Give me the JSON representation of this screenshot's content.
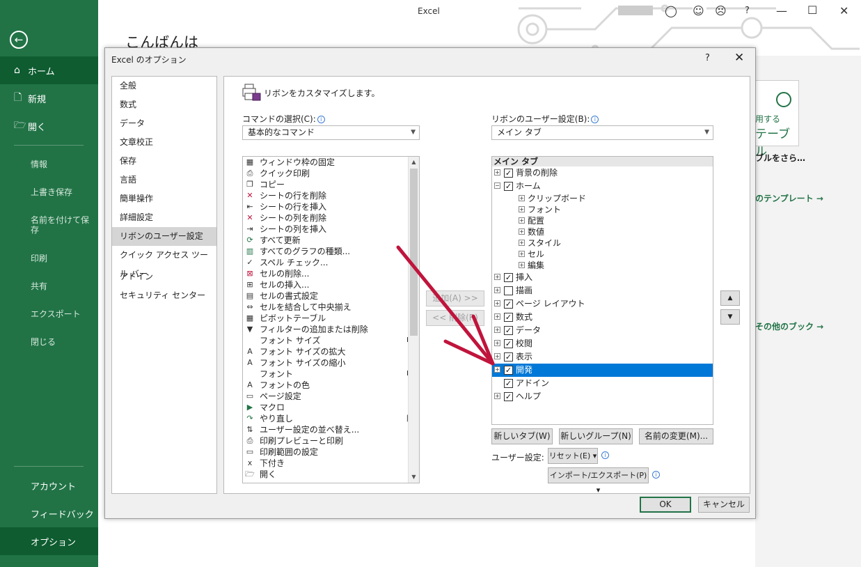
{
  "app": {
    "title": "Excel",
    "greeting": "こんばんは"
  },
  "backstage": {
    "main_items": [
      {
        "label": "ホーム",
        "icon": "home-icon"
      },
      {
        "label": "新規",
        "icon": "new-file-icon"
      },
      {
        "label": "開く",
        "icon": "folder-open-icon"
      }
    ],
    "sub_items": [
      "情報",
      "上書き保存",
      "名前を付けて保存",
      "印刷",
      "共有",
      "エクスポート",
      "閉じる"
    ],
    "bottom_items": [
      "アカウント",
      "フィードバック",
      "オプション"
    ]
  },
  "background": {
    "card_line1": "用する",
    "card_line2": "テーブル",
    "card_line3": "ブルをさら…",
    "link1": "のテンプレート →",
    "link2": "その他のブック →"
  },
  "dialog": {
    "title": "Excel のオプション",
    "help": "?",
    "close": "✕",
    "nav": [
      "全般",
      "数式",
      "データ",
      "文章校正",
      "保存",
      "言語",
      "簡単操作",
      "詳細設定",
      "リボンのユーザー設定",
      "クイック アクセス ツール バー",
      "アドイン",
      "セキュリティ センター"
    ],
    "nav_selected": 8,
    "heading": "リボンをカスタマイズします。",
    "commands_label": "コマンドの選択(C):",
    "commands_combo": "基本的なコマンド",
    "ribbon_label": "リボンのユーザー設定(B):",
    "ribbon_combo": "メイン タブ",
    "commands": [
      {
        "label": "ウィンドウ枠の固定",
        "icon": "freeze-panes-icon",
        "right": "▸"
      },
      {
        "label": "クイック印刷",
        "icon": "quick-print-icon",
        "right": ""
      },
      {
        "label": "コピー",
        "icon": "copy-icon",
        "right": ""
      },
      {
        "label": "シートの行を削除",
        "icon": "delete-row-icon",
        "right": ""
      },
      {
        "label": "シートの行を挿入",
        "icon": "insert-row-icon",
        "right": ""
      },
      {
        "label": "シートの列を削除",
        "icon": "delete-column-icon",
        "right": ""
      },
      {
        "label": "シートの列を挿入",
        "icon": "insert-column-icon",
        "right": ""
      },
      {
        "label": "すべて更新",
        "icon": "refresh-all-icon",
        "right": ""
      },
      {
        "label": "すべてのグラフの種類...",
        "icon": "chart-icon",
        "right": ""
      },
      {
        "label": "スペル チェック...",
        "icon": "spelling-icon",
        "right": ""
      },
      {
        "label": "セルの削除...",
        "icon": "delete-cells-icon",
        "right": ""
      },
      {
        "label": "セルの挿入...",
        "icon": "insert-cells-icon",
        "right": ""
      },
      {
        "label": "セルの書式設定",
        "icon": "format-cells-icon",
        "right": ""
      },
      {
        "label": "セルを結合して中央揃え",
        "icon": "merge-center-icon",
        "right": ""
      },
      {
        "label": "ピボットテーブル",
        "icon": "pivot-table-icon",
        "right": ""
      },
      {
        "label": "フィルターの追加または削除",
        "icon": "filter-icon",
        "right": ""
      },
      {
        "label": "フォント サイズ",
        "icon": "",
        "right": "I▾"
      },
      {
        "label": "フォント サイズの拡大",
        "icon": "font-grow-icon",
        "right": ""
      },
      {
        "label": "フォント サイズの縮小",
        "icon": "font-shrink-icon",
        "right": ""
      },
      {
        "label": "フォント",
        "icon": "",
        "right": "I▾"
      },
      {
        "label": "フォントの色",
        "icon": "font-color-icon",
        "right": "▸"
      },
      {
        "label": "ページ設定",
        "icon": "page-setup-icon",
        "right": ""
      },
      {
        "label": "マクロ",
        "icon": "macro-icon",
        "right": ""
      },
      {
        "label": "やり直し",
        "icon": "redo-icon",
        "right": "|▸"
      },
      {
        "label": "ユーザー設定の並べ替え...",
        "icon": "custom-sort-icon",
        "right": ""
      },
      {
        "label": "印刷プレビューと印刷",
        "icon": "print-preview-icon",
        "right": ""
      },
      {
        "label": "印刷範囲の設定",
        "icon": "print-area-icon",
        "right": ""
      },
      {
        "label": "下付き",
        "icon": "subscript-icon",
        "right": ""
      },
      {
        "label": "開く",
        "icon": "open-icon",
        "right": ""
      }
    ],
    "add_button": "追加(A) >>",
    "remove_button": "<< 削除(R)",
    "tree_header": "メイン タブ",
    "tree": [
      {
        "label": "背景の削除",
        "level": 0,
        "expand": "+",
        "checked": true
      },
      {
        "label": "ホーム",
        "level": 0,
        "expand": "−",
        "checked": true
      },
      {
        "label": "クリップボード",
        "level": 1,
        "expand": "+"
      },
      {
        "label": "フォント",
        "level": 1,
        "expand": "+"
      },
      {
        "label": "配置",
        "level": 1,
        "expand": "+"
      },
      {
        "label": "数値",
        "level": 1,
        "expand": "+"
      },
      {
        "label": "スタイル",
        "level": 1,
        "expand": "+"
      },
      {
        "label": "セル",
        "level": 1,
        "expand": "+"
      },
      {
        "label": "編集",
        "level": 1,
        "expand": "+"
      },
      {
        "label": "挿入",
        "level": 0,
        "expand": "+",
        "checked": true
      },
      {
        "label": "描画",
        "level": 0,
        "expand": "+",
        "checked": false
      },
      {
        "label": "ページ レイアウト",
        "level": 0,
        "expand": "+",
        "checked": true
      },
      {
        "label": "数式",
        "level": 0,
        "expand": "+",
        "checked": true
      },
      {
        "label": "データ",
        "level": 0,
        "expand": "+",
        "checked": true
      },
      {
        "label": "校閲",
        "level": 0,
        "expand": "+",
        "checked": true
      },
      {
        "label": "表示",
        "level": 0,
        "expand": "+",
        "checked": true
      },
      {
        "label": "開発",
        "level": 0,
        "expand": "+",
        "checked": true,
        "selected": true
      },
      {
        "label": "アドイン",
        "level": 0,
        "expand": "",
        "checked": true
      },
      {
        "label": "ヘルプ",
        "level": 0,
        "expand": "+",
        "checked": true
      }
    ],
    "new_tab_button": "新しいタブ(W)",
    "new_group_button": "新しいグループ(N)",
    "rename_button": "名前の変更(M)...",
    "user_settings_label": "ユーザー設定:",
    "reset_button": "リセット(E) ▾",
    "import_export_button": "インポート/エクスポート(P) ▾",
    "ok_button": "OK",
    "cancel_button": "キャンセル"
  },
  "colors": {
    "accent": "#217346",
    "selection": "#0078d7",
    "annotation_arrow": "#c0143c"
  }
}
